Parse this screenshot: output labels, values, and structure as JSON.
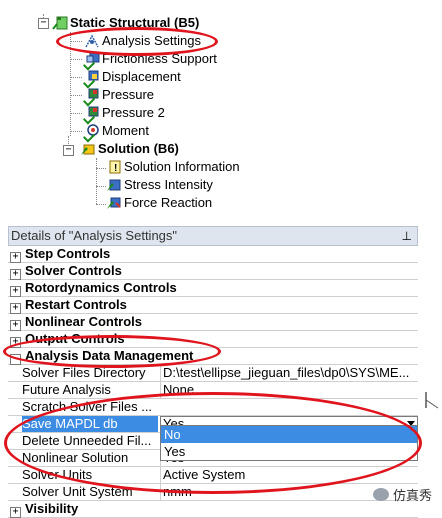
{
  "tree": {
    "items": [
      {
        "label": "Static Structural (B5)",
        "bold": true,
        "icon": "static-structural-icon"
      },
      {
        "label": "Analysis Settings",
        "bold": false,
        "icon": "analysis-settings-icon"
      },
      {
        "label": "Frictionless Support",
        "bold": false,
        "icon": "frictionless-support-icon"
      },
      {
        "label": "Displacement",
        "bold": false,
        "icon": "displacement-icon"
      },
      {
        "label": "Pressure",
        "bold": false,
        "icon": "pressure-icon"
      },
      {
        "label": "Pressure 2",
        "bold": false,
        "icon": "pressure-icon"
      },
      {
        "label": "Moment",
        "bold": false,
        "icon": "moment-icon"
      },
      {
        "label": "Solution (B6)",
        "bold": true,
        "icon": "solution-icon"
      },
      {
        "label": "Solution Information",
        "bold": false,
        "icon": "solution-information-icon"
      },
      {
        "label": "Stress Intensity",
        "bold": false,
        "icon": "stress-intensity-icon"
      },
      {
        "label": "Force Reaction",
        "bold": false,
        "icon": "force-reaction-icon"
      }
    ]
  },
  "details": {
    "title": "Details of \"Analysis Settings\"",
    "pin": "พ",
    "groups_top": [
      {
        "label": "Step Controls",
        "sign": "+"
      },
      {
        "label": "Solver Controls",
        "sign": "+"
      },
      {
        "label": "Rotordynamics Controls",
        "sign": "+"
      },
      {
        "label": "Restart Controls",
        "sign": "+"
      },
      {
        "label": "Nonlinear Controls",
        "sign": "+"
      },
      {
        "label": "Output Controls",
        "sign": "+"
      },
      {
        "label": "Analysis Data Management",
        "sign": "-"
      }
    ],
    "props": [
      {
        "name": "Solver Files Directory",
        "value": "D:\\test\\ellipse_jieguan_files\\dp0\\SYS\\ME..."
      },
      {
        "name": "Future Analysis",
        "value": "None"
      },
      {
        "name": "Scratch Solver Files ...",
        "value": ""
      },
      {
        "name": "Save MAPDL db",
        "value": "Yes"
      },
      {
        "name": "Delete Unneeded Fil...",
        "value": "No"
      },
      {
        "name": "Nonlinear Solution",
        "value": "Yes"
      },
      {
        "name": "Solver Units",
        "value": "Active System"
      },
      {
        "name": "Solver Unit System",
        "value": "nmm"
      }
    ],
    "group_bottom": {
      "label": "Visibility",
      "sign": "+"
    },
    "dropdown_options": [
      "No",
      "Yes"
    ],
    "highlighted_option": "No"
  },
  "watermark": {
    "text": "仿真秀"
  },
  "colors": {
    "annotation": "#e0141c",
    "selection": "#3d8ce3",
    "header_bg": "#dfe5ee"
  }
}
